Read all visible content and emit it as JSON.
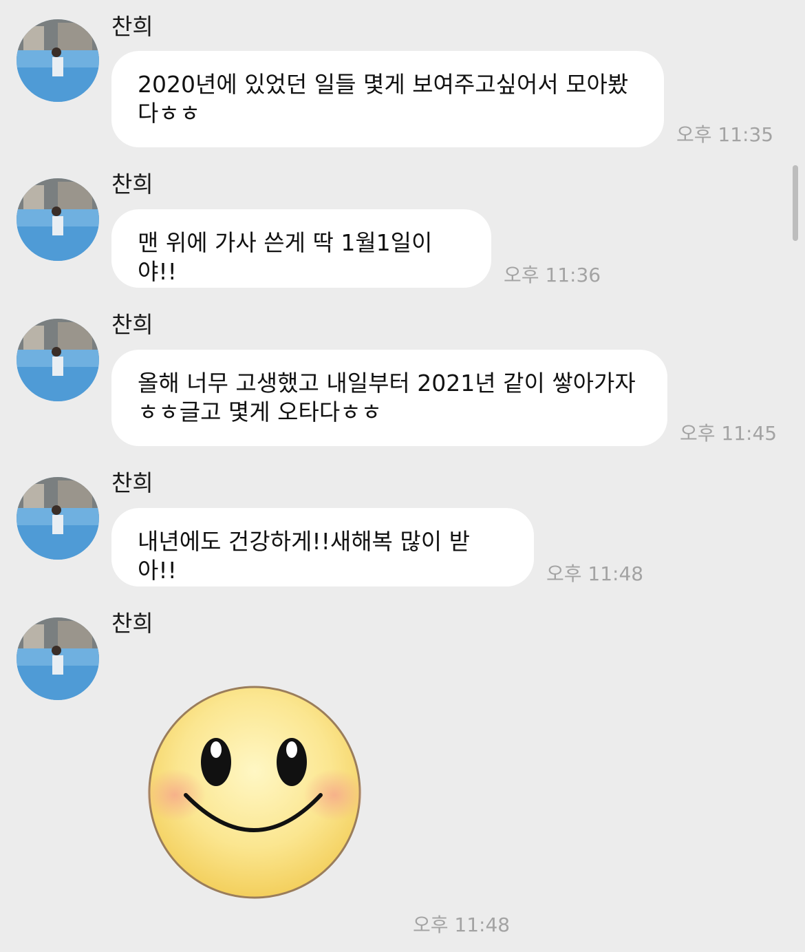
{
  "conversation": {
    "messages": [
      {
        "sender": "찬희",
        "text": "2020년에 있었던 일들 몇게 보여주고싶어서 모아봤\n다ㅎㅎ",
        "time": "오후 11:35"
      },
      {
        "sender": "찬희",
        "text": "맨 위에 가사 쓴게 딱 1월1일이야!!",
        "time": "오후 11:36"
      },
      {
        "sender": "찬희",
        "text": "올해 너무 고생했고 내일부터 2021년 같이 쌓아가자\nㅎㅎ글고 몇게 오타다ㅎㅎ",
        "time": "오후 11:45"
      },
      {
        "sender": "찬희",
        "text": "내년에도 건강하게!!새해복 많이 받아!!",
        "time": "오후 11:48"
      },
      {
        "sender": "찬희",
        "sticker": "smiley-face-emoticon",
        "time": "오후 11:48"
      }
    ]
  },
  "colors": {
    "background": "#ececec",
    "bubble": "#ffffff",
    "time_text": "#a3a3a3",
    "emoticon_face": "#fbe690"
  }
}
